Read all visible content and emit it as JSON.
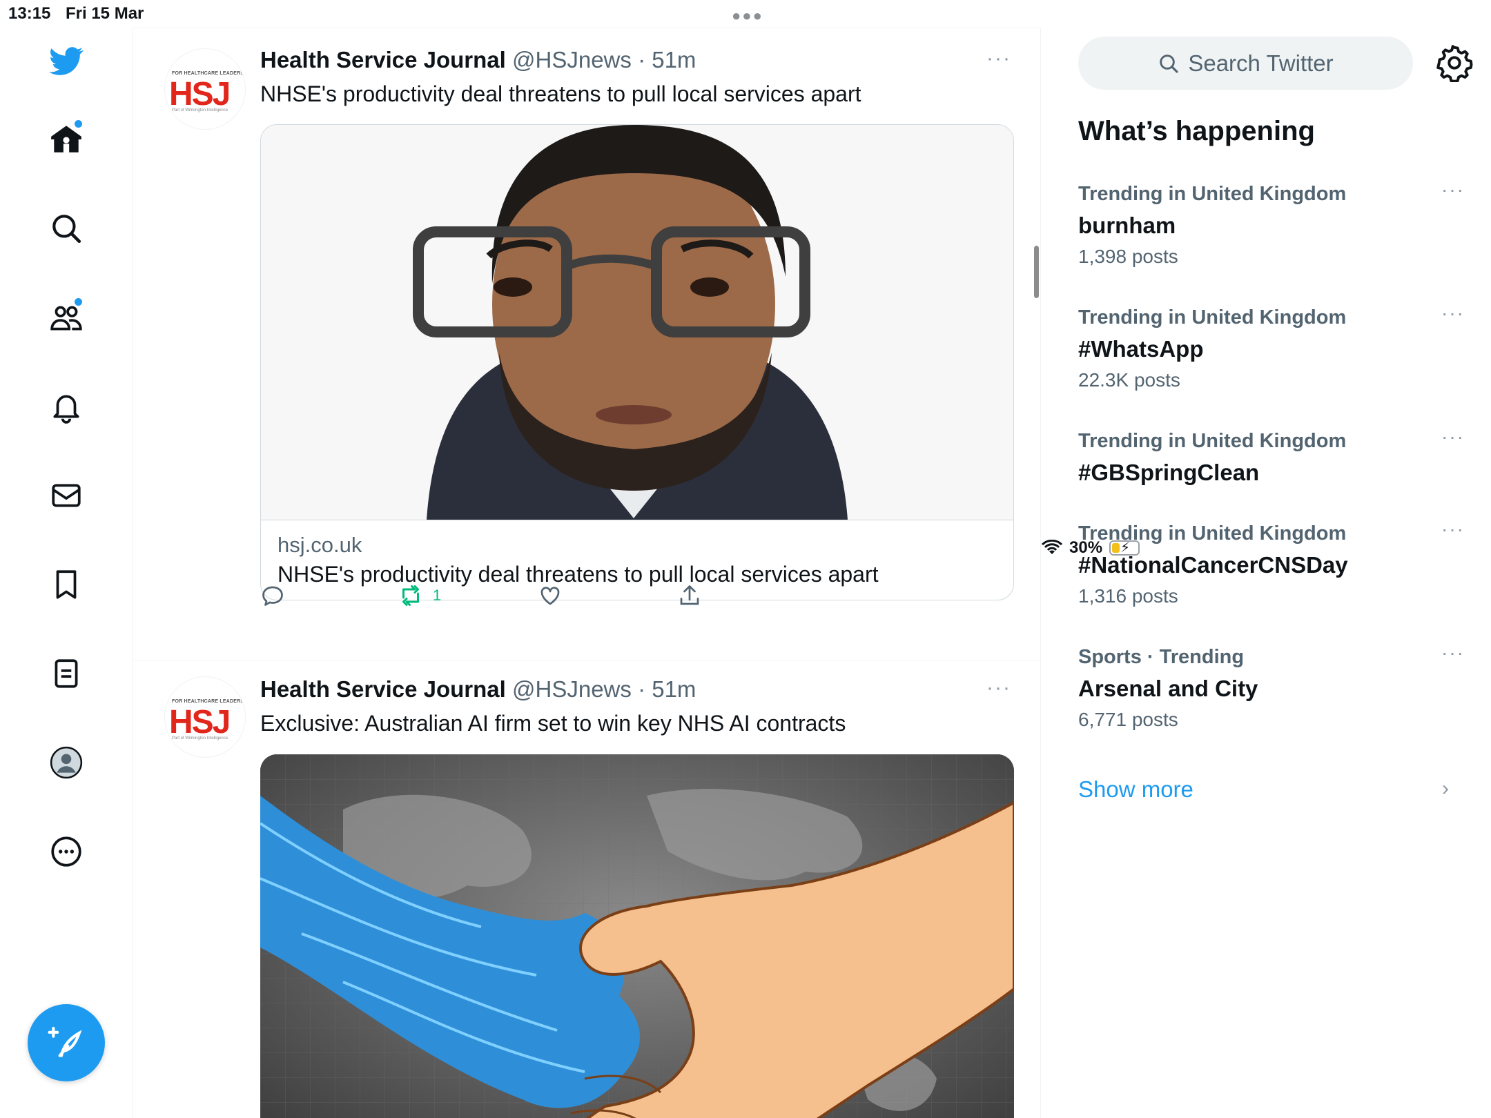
{
  "status": {
    "time": "13:15",
    "date": "Fri 15 Mar",
    "battery": "30%",
    "battery_level": 0.3
  },
  "nav": {
    "items": [
      "twitter-logo",
      "home",
      "explore",
      "communities",
      "notifications",
      "messages",
      "bookmarks",
      "lists",
      "profile",
      "more"
    ],
    "compose_icon": "feather-plus-icon"
  },
  "tweets": [
    {
      "name": "Health Service Journal",
      "handle": "@HSJnews",
      "time": "· 51m",
      "text": "NHSE's productivity deal threatens to pull local services apart",
      "card_domain": "hsj.co.uk",
      "card_title": "NHSE's productivity deal threatens to pull local services apart",
      "retweets": "1",
      "avatar": {
        "top": "FOR HEALTHCARE LEADERS",
        "logo": "HSJ",
        "sub": "Part of Wilmington Intelligence"
      }
    },
    {
      "name": "Health Service Journal",
      "handle": "@HSJnews",
      "time": "· 51m",
      "text": "Exclusive: Australian AI firm set to win key NHS AI contracts",
      "avatar": {
        "top": "FOR HEALTHCARE LEADERS",
        "logo": "HSJ",
        "sub": "Part of Wilmington Intelligence"
      }
    }
  ],
  "right": {
    "search_placeholder": "Search Twitter",
    "heading": "What’s happening",
    "trends": [
      {
        "context": "Trending in United Kingdom",
        "name": "burnham",
        "count": "1,398 posts"
      },
      {
        "context": "Trending in United Kingdom",
        "name": "#WhatsApp",
        "count": "22.3K posts"
      },
      {
        "context": "Trending in United Kingdom",
        "name": "#GBSpringClean",
        "count": ""
      },
      {
        "context": "Trending in United Kingdom",
        "name": "#NationalCancerCNSDay",
        "count": "1,316 posts"
      },
      {
        "context": "Sports · Trending",
        "name": "Arsenal and City",
        "count": "6,771 posts"
      }
    ],
    "show_more": "Show more"
  },
  "colors": {
    "accent": "#1d9bf0",
    "retweet_green": "#00ba7c",
    "hsj_red": "#e1261c"
  }
}
